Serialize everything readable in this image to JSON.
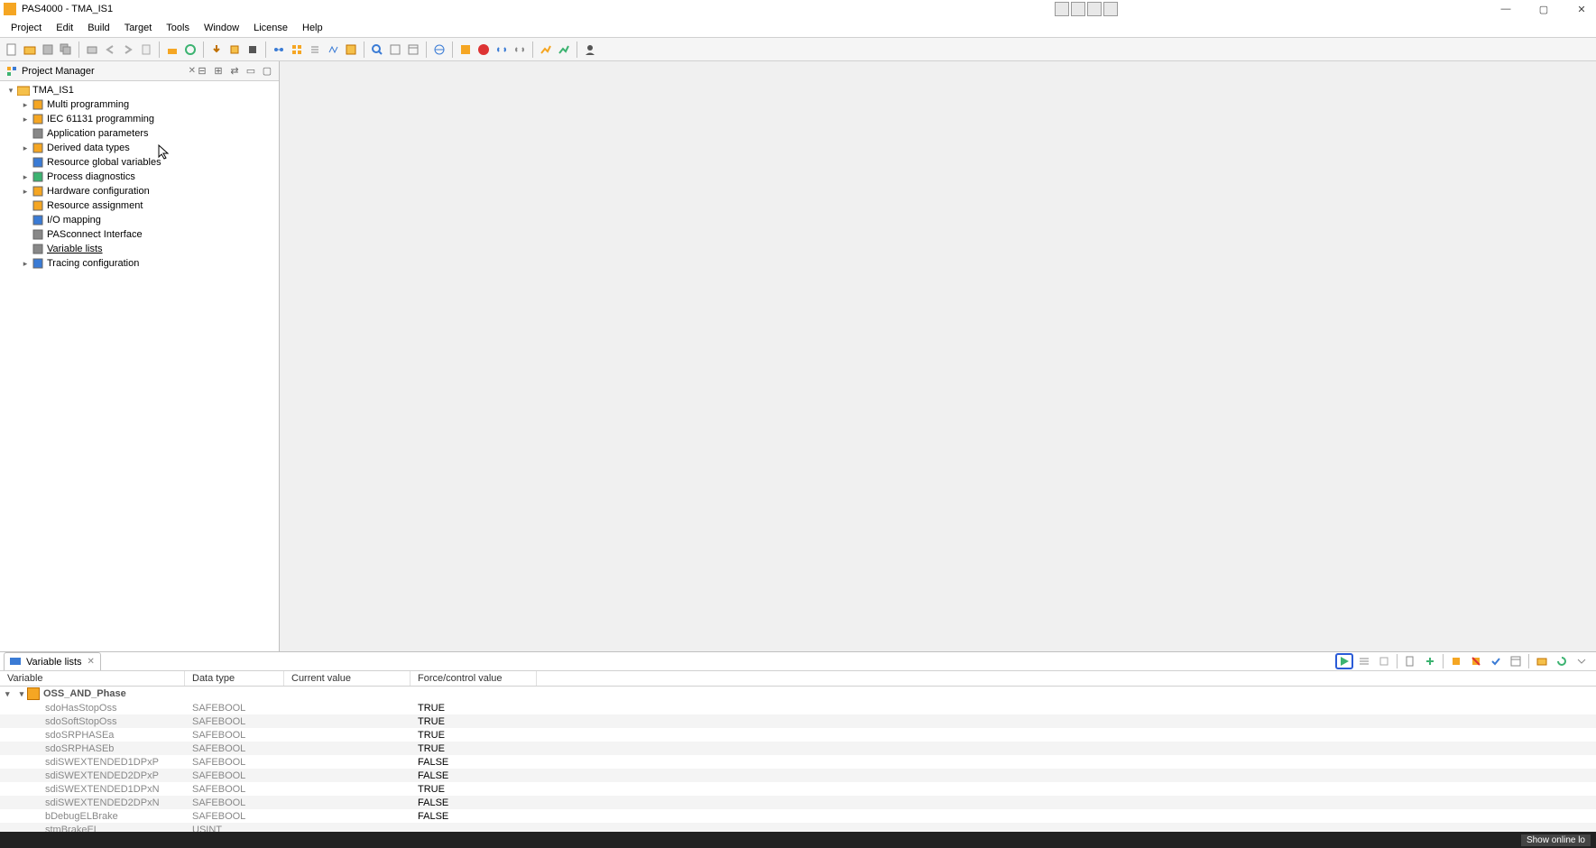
{
  "title": "PAS4000 - TMA_IS1",
  "menu": [
    "Project",
    "Edit",
    "Build",
    "Target",
    "Tools",
    "Window",
    "License",
    "Help"
  ],
  "project_manager": {
    "title": "Project Manager",
    "root": "TMA_IS1",
    "items": [
      {
        "label": "Multi programming",
        "twisty": "▸",
        "icon": "orange"
      },
      {
        "label": "IEC 61131 programming",
        "twisty": "▸",
        "icon": "orange"
      },
      {
        "label": "Application parameters",
        "twisty": "",
        "icon": "gray"
      },
      {
        "label": "Derived data types",
        "twisty": "▸",
        "icon": "orange"
      },
      {
        "label": "Resource global variables",
        "twisty": "",
        "icon": "blue"
      },
      {
        "label": "Process diagnostics",
        "twisty": "▸",
        "icon": "green"
      },
      {
        "label": "Hardware configuration",
        "twisty": "▸",
        "icon": "orange"
      },
      {
        "label": "Resource assignment",
        "twisty": "",
        "icon": "orange"
      },
      {
        "label": "I/O mapping",
        "twisty": "",
        "icon": "blue"
      },
      {
        "label": "PASconnect Interface",
        "twisty": "",
        "icon": "gray"
      },
      {
        "label": "Variable lists",
        "twisty": "",
        "icon": "gray",
        "selected": true
      },
      {
        "label": "Tracing configuration",
        "twisty": "▸",
        "icon": "blue"
      }
    ]
  },
  "variable_lists": {
    "tab": "Variable lists",
    "columns": [
      "Variable",
      "Data type",
      "Current value",
      "Force/control value"
    ],
    "group": "OSS_AND_Phase",
    "rows": [
      {
        "var": "sdoHasStopOss",
        "type": "SAFEBOOL",
        "cur": "",
        "force": "TRUE"
      },
      {
        "var": "sdoSoftStopOss",
        "type": "SAFEBOOL",
        "cur": "",
        "force": "TRUE"
      },
      {
        "var": "sdoSRPHASEa",
        "type": "SAFEBOOL",
        "cur": "",
        "force": "TRUE"
      },
      {
        "var": "sdoSRPHASEb",
        "type": "SAFEBOOL",
        "cur": "",
        "force": "TRUE"
      },
      {
        "var": "sdiSWEXTENDED1DPxP",
        "type": "SAFEBOOL",
        "cur": "",
        "force": "FALSE"
      },
      {
        "var": "sdiSWEXTENDED2DPxP",
        "type": "SAFEBOOL",
        "cur": "",
        "force": "FALSE"
      },
      {
        "var": "sdiSWEXTENDED1DPxN",
        "type": "SAFEBOOL",
        "cur": "",
        "force": "TRUE"
      },
      {
        "var": "sdiSWEXTENDED2DPxN",
        "type": "SAFEBOOL",
        "cur": "",
        "force": "FALSE"
      },
      {
        "var": "bDebugELBrake",
        "type": "SAFEBOOL",
        "cur": "",
        "force": "FALSE"
      },
      {
        "var": "stmBrakeEL",
        "type": "USINT",
        "cur": "",
        "force": ""
      }
    ]
  },
  "statusbar": {
    "right": "Show online lo"
  }
}
